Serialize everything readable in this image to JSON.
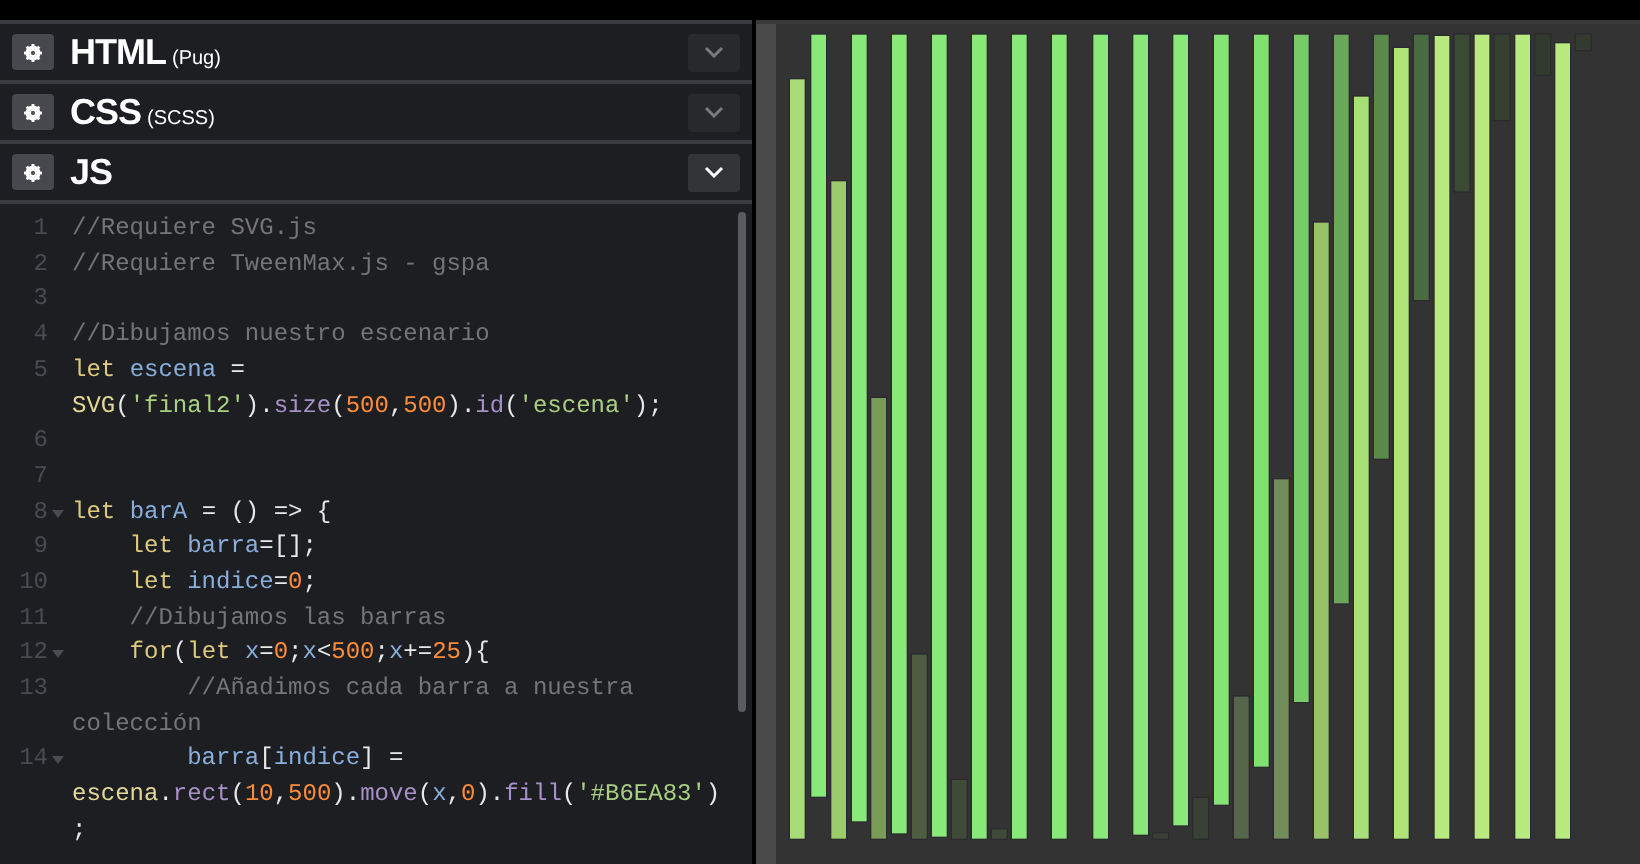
{
  "panes": [
    {
      "title": "HTML",
      "subtitle": "(Pug)",
      "active": false
    },
    {
      "title": "CSS",
      "subtitle": "(SCSS)",
      "active": false
    },
    {
      "title": "JS",
      "active": true
    }
  ],
  "code": [
    {
      "number": "1",
      "foldable": false,
      "rows": [
        {
          "tokens": [
            {
              "kind": "comment",
              "text": "//Requiere SVG.js"
            }
          ]
        }
      ]
    },
    {
      "number": "2",
      "foldable": false,
      "rows": [
        {
          "tokens": [
            {
              "kind": "comment",
              "text": "//Requiere TweenMax.js - gspa"
            }
          ]
        }
      ]
    },
    {
      "number": "3",
      "foldable": false
    },
    {
      "number": "4",
      "foldable": false,
      "rows": [
        {
          "tokens": [
            {
              "kind": "comment",
              "text": "//Dibujamos nuestro escenario"
            }
          ]
        }
      ]
    },
    {
      "number": "5",
      "foldable": false,
      "rows": [
        {
          "tokens": [
            {
              "kind": "keyword",
              "text": "let "
            },
            {
              "kind": "variable",
              "text": "escena"
            },
            {
              "kind": "plain",
              "text": " ="
            }
          ]
        },
        {
          "tokens": [
            {
              "kind": "func",
              "text": "SVG"
            },
            {
              "kind": "plain",
              "text": "("
            },
            {
              "kind": "string",
              "text": "'final2'"
            },
            {
              "kind": "plain",
              "text": ")."
            },
            {
              "kind": "method",
              "text": "size"
            },
            {
              "kind": "plain",
              "text": "("
            },
            {
              "kind": "number",
              "text": "500"
            },
            {
              "kind": "plain",
              "text": ","
            },
            {
              "kind": "number",
              "text": "500"
            },
            {
              "kind": "plain",
              "text": ")."
            },
            {
              "kind": "method",
              "text": "id"
            },
            {
              "kind": "plain",
              "text": "("
            },
            {
              "kind": "string",
              "text": "'escena'"
            },
            {
              "kind": "plain",
              "text": ");"
            }
          ]
        }
      ]
    },
    {
      "number": "6",
      "foldable": false
    },
    {
      "number": "7",
      "foldable": false
    },
    {
      "number": "8",
      "foldable": true,
      "rows": [
        {
          "tokens": [
            {
              "kind": "keyword",
              "text": "let "
            },
            {
              "kind": "variable",
              "text": "barA"
            },
            {
              "kind": "plain",
              "text": " = () => {"
            }
          ]
        }
      ]
    },
    {
      "number": "9",
      "foldable": false,
      "rows": [
        {
          "tokens": [
            {
              "kind": "keyword",
              "text": "    let "
            },
            {
              "kind": "variable",
              "text": "barra"
            },
            {
              "kind": "plain",
              "text": "=[];"
            }
          ]
        }
      ]
    },
    {
      "number": "10",
      "foldable": false,
      "rows": [
        {
          "tokens": [
            {
              "kind": "keyword",
              "text": "    let "
            },
            {
              "kind": "variable",
              "text": "indice"
            },
            {
              "kind": "plain",
              "text": "="
            },
            {
              "kind": "number",
              "text": "0"
            },
            {
              "kind": "plain",
              "text": ";"
            }
          ]
        }
      ]
    },
    {
      "number": "11",
      "foldable": false,
      "rows": [
        {
          "tokens": [
            {
              "kind": "comment",
              "text": "    //Dibujamos las barras"
            }
          ]
        }
      ]
    },
    {
      "number": "12",
      "foldable": true,
      "rows": [
        {
          "tokens": [
            {
              "kind": "keyword",
              "text": "    for"
            },
            {
              "kind": "plain",
              "text": "("
            },
            {
              "kind": "keyword",
              "text": "let "
            },
            {
              "kind": "variable",
              "text": "x"
            },
            {
              "kind": "plain",
              "text": "="
            },
            {
              "kind": "number",
              "text": "0"
            },
            {
              "kind": "plain",
              "text": ";"
            },
            {
              "kind": "variable",
              "text": "x"
            },
            {
              "kind": "plain",
              "text": "<"
            },
            {
              "kind": "number",
              "text": "500"
            },
            {
              "kind": "plain",
              "text": ";"
            },
            {
              "kind": "variable",
              "text": "x"
            },
            {
              "kind": "plain",
              "text": "+="
            },
            {
              "kind": "number",
              "text": "25"
            },
            {
              "kind": "plain",
              "text": "){"
            }
          ]
        }
      ]
    },
    {
      "number": "13",
      "foldable": false,
      "rows": [
        {
          "tokens": [
            {
              "kind": "comment",
              "text": "        //Añadimos cada barra a nuestra"
            }
          ]
        },
        {
          "tokens": [
            {
              "kind": "comment",
              "text": "colección"
            }
          ]
        }
      ]
    },
    {
      "number": "14",
      "foldable": true,
      "rows": [
        {
          "tokens": [
            {
              "kind": "variable",
              "text": "        barra"
            },
            {
              "kind": "plain",
              "text": "["
            },
            {
              "kind": "variable",
              "text": "indice"
            },
            {
              "kind": "plain",
              "text": "] ="
            }
          ]
        },
        {
          "tokens": [
            {
              "kind": "func",
              "text": "escena"
            },
            {
              "kind": "plain",
              "text": "."
            },
            {
              "kind": "method",
              "text": "rect"
            },
            {
              "kind": "plain",
              "text": "("
            },
            {
              "kind": "number",
              "text": "10"
            },
            {
              "kind": "plain",
              "text": ","
            },
            {
              "kind": "number",
              "text": "500"
            },
            {
              "kind": "plain",
              "text": ")."
            },
            {
              "kind": "method",
              "text": "move"
            },
            {
              "kind": "plain",
              "text": "("
            },
            {
              "kind": "variable",
              "text": "x"
            },
            {
              "kind": "plain",
              "text": ","
            },
            {
              "kind": "number",
              "text": "0"
            },
            {
              "kind": "plain",
              "text": ")."
            },
            {
              "kind": "method",
              "text": "fill"
            },
            {
              "kind": "plain",
              "text": "("
            },
            {
              "kind": "string",
              "text": "'#B6EA83'"
            },
            {
              "kind": "plain",
              "text": ")"
            }
          ]
        },
        {
          "tokens": [
            {
              "kind": "plain",
              "text": ";"
            }
          ]
        }
      ]
    }
  ]
}
